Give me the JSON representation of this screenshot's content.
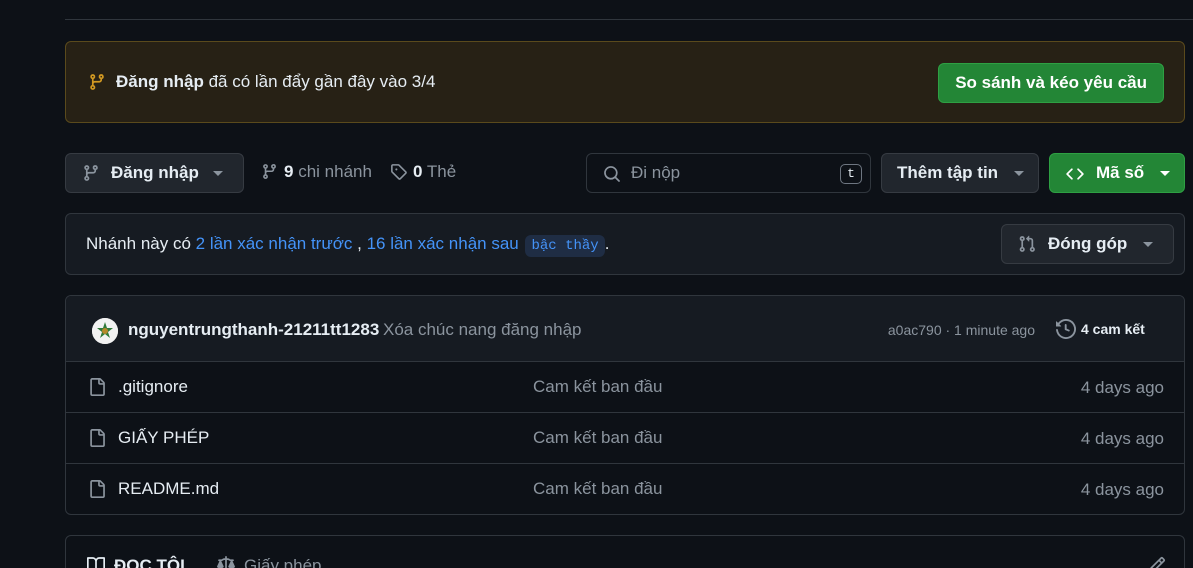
{
  "banner": {
    "branch": "Đăng nhập",
    "text": "đã có lần đẩy gần đây vào 3/4",
    "compare_button": "So sánh và kéo yêu cầu"
  },
  "toolbar": {
    "branch_select": "Đăng nhập",
    "branch_count": "9",
    "branch_label": "chi nhánh",
    "tag_count": "0",
    "tag_label": "Thẻ",
    "search_placeholder": "Đi nộp",
    "search_shortcut": "t",
    "add_file": "Thêm tập tin",
    "code": "Mã số"
  },
  "ahead_behind": {
    "prefix": "Nhánh này có",
    "ahead": "2 lần xác nhận trước",
    "separator": ",",
    "behind": "16 lần xác nhận sau",
    "base_branch": "bậc thầy",
    "suffix": ".",
    "contribute": "Đóng góp"
  },
  "latest_commit": {
    "author": "nguyentrungthanh-21211tt1283",
    "message": "Xóa chúc nang đăng nhập",
    "hash_time": "a0ac790 · 1 minute ago",
    "count": "4 cam kết"
  },
  "files": [
    {
      "name": ".gitignore",
      "message": "Cam kết ban đầu",
      "age": "4 days ago"
    },
    {
      "name": "GIẤY PHÉP",
      "message": "Cam kết ban đầu",
      "age": "4 days ago"
    },
    {
      "name": "README.md",
      "message": "Cam kết ban đầu",
      "age": "4 days ago"
    }
  ],
  "readme": {
    "tab_readme": "ĐỌC TÔI",
    "tab_license": "Giấy phép"
  },
  "colors": {
    "background": "#0d1117",
    "accent_green": "#238636",
    "link_blue": "#4493f8",
    "banner_bg": "#272115"
  }
}
